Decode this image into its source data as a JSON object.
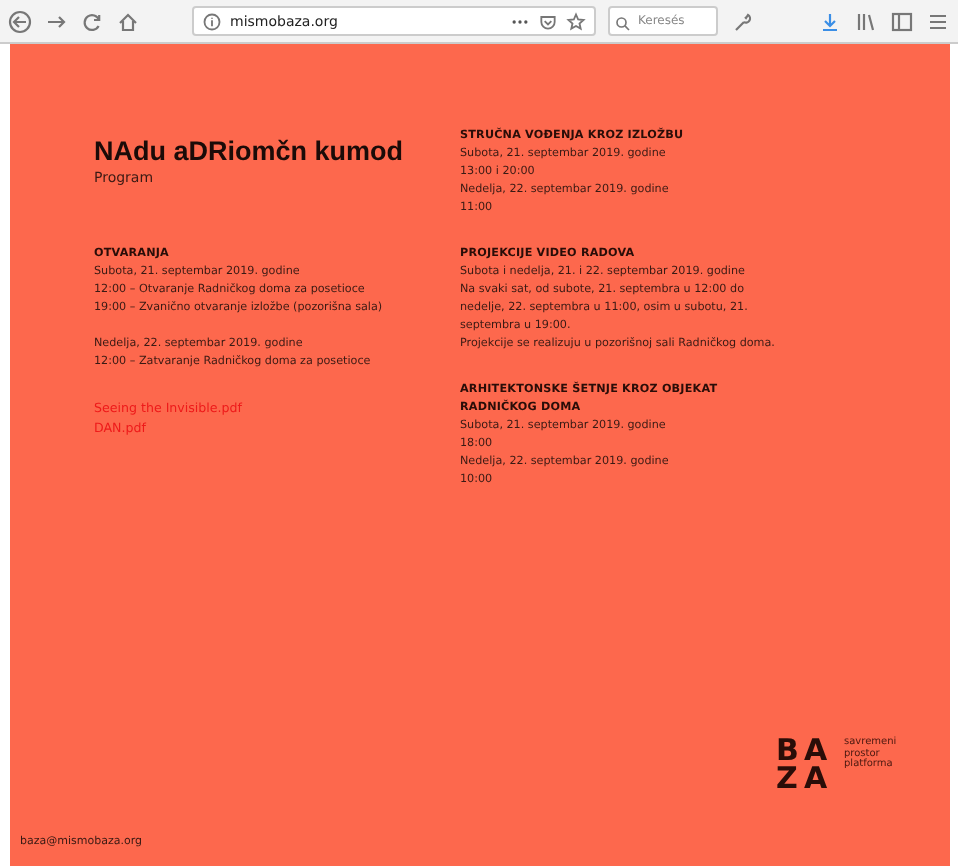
{
  "browser": {
    "url": "mismobaza.org",
    "search_placeholder": "Keresés"
  },
  "page": {
    "title": "NAdu aDRiomčn kumod",
    "subtitle": "Program",
    "left_sections": [
      {
        "heading": "OTVARANJA",
        "lines": [
          "Subota, 21. septembar 2019. godine",
          "12:00 – Otvaranje Radničkog doma za posetioce",
          "19:00 – Zvanično otvaranje izložbe (pozorišna sala)"
        ]
      },
      {
        "lines": [
          "Nedelja, 22. septembar 2019. godine",
          "12:00 – Zatvaranje Radničkog doma za posetioce"
        ]
      }
    ],
    "links": [
      "Seeing the Invisible.pdf",
      "DAN.pdf"
    ],
    "right_sections": [
      {
        "heading": "STRUČNA VOĐENJA KROZ IZLOŽBU",
        "lines": [
          "Subota, 21. septembar 2019. godine",
          "13:00 i 20:00",
          "Nedelja, 22. septembar 2019. godine",
          "11:00"
        ]
      },
      {
        "heading": "PROJEKCIJE VIDEO RADOVA",
        "lines": [
          "Subota i nedelja, 21. i 22. septembar 2019. godine",
          "Na svaki sat, od subote, 21. septembra u 12:00 do nedelje, 22. septembra u 11:00, osim u subotu, 21. septembra u 19:00.",
          "Projekcije se realizuju u pozorišnoj sali Radničkog doma."
        ]
      },
      {
        "heading": "ARHITEKTONSKE ŠETNJE KROZ OBJEKAT RADNIČKOG DOMA",
        "lines": [
          "Subota, 21. septembar 2019. godine",
          "18:00",
          "Nedelja, 22. septembar 2019. godine",
          "10:00"
        ]
      }
    ],
    "logo": {
      "letters": [
        "B",
        "A",
        "Z",
        "A"
      ],
      "tagline": [
        "savremeni",
        "prostor",
        "platforma"
      ]
    },
    "email": "baza@mismobaza.org"
  }
}
